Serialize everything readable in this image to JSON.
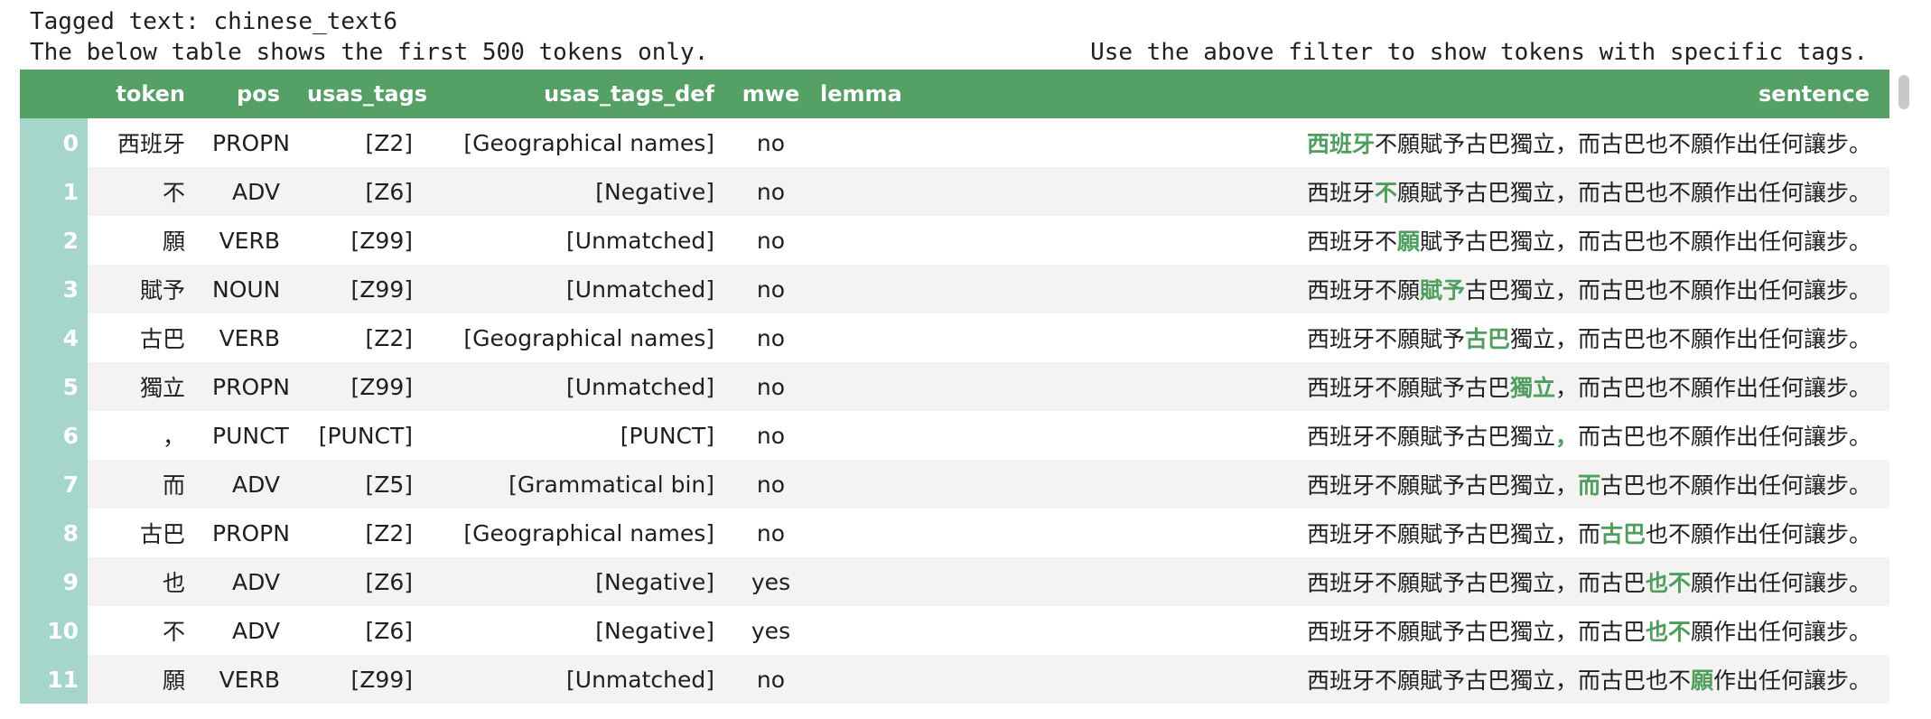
{
  "caption": {
    "title": "Tagged text: chinese_text6",
    "left_note": "The below table shows the first 500 tokens only.",
    "right_note": "Use the above filter to show tokens with specific tags."
  },
  "table": {
    "headers": {
      "index": "",
      "token": "token",
      "pos": "pos",
      "usas_tags": "usas_tags",
      "usas_tags_def": "usas_tags_def",
      "mwe": "mwe",
      "lemma": "lemma",
      "sentence": "sentence"
    },
    "rows": [
      {
        "index": "0",
        "token": "西班牙",
        "pos": "PROPN",
        "usas_tags": "[Z2]",
        "usas_tags_def": "[Geographical names]",
        "mwe": "no",
        "lemma": "",
        "sentence": {
          "before": "",
          "highlight": "西班牙",
          "after": "不願賦予古巴獨立，而古巴也不願作出任何讓步。"
        }
      },
      {
        "index": "1",
        "token": "不",
        "pos": "ADV",
        "usas_tags": "[Z6]",
        "usas_tags_def": "[Negative]",
        "mwe": "no",
        "lemma": "",
        "sentence": {
          "before": "西班牙",
          "highlight": "不",
          "after": "願賦予古巴獨立，而古巴也不願作出任何讓步。"
        }
      },
      {
        "index": "2",
        "token": "願",
        "pos": "VERB",
        "usas_tags": "[Z99]",
        "usas_tags_def": "[Unmatched]",
        "mwe": "no",
        "lemma": "",
        "sentence": {
          "before": "西班牙不",
          "highlight": "願",
          "after": "賦予古巴獨立，而古巴也不願作出任何讓步。"
        }
      },
      {
        "index": "3",
        "token": "賦予",
        "pos": "NOUN",
        "usas_tags": "[Z99]",
        "usas_tags_def": "[Unmatched]",
        "mwe": "no",
        "lemma": "",
        "sentence": {
          "before": "西班牙不願",
          "highlight": "賦予",
          "after": "古巴獨立，而古巴也不願作出任何讓步。"
        }
      },
      {
        "index": "4",
        "token": "古巴",
        "pos": "VERB",
        "usas_tags": "[Z2]",
        "usas_tags_def": "[Geographical names]",
        "mwe": "no",
        "lemma": "",
        "sentence": {
          "before": "西班牙不願賦予",
          "highlight": "古巴",
          "after": "獨立，而古巴也不願作出任何讓步。"
        }
      },
      {
        "index": "5",
        "token": "獨立",
        "pos": "PROPN",
        "usas_tags": "[Z99]",
        "usas_tags_def": "[Unmatched]",
        "mwe": "no",
        "lemma": "",
        "sentence": {
          "before": "西班牙不願賦予古巴",
          "highlight": "獨立",
          "after": "，而古巴也不願作出任何讓步。"
        }
      },
      {
        "index": "6",
        "token": "，",
        "pos": "PUNCT",
        "usas_tags": "[PUNCT]",
        "usas_tags_def": "[PUNCT]",
        "mwe": "no",
        "lemma": "",
        "sentence": {
          "before": "西班牙不願賦予古巴獨立",
          "highlight": "，",
          "after": "而古巴也不願作出任何讓步。"
        }
      },
      {
        "index": "7",
        "token": "而",
        "pos": "ADV",
        "usas_tags": "[Z5]",
        "usas_tags_def": "[Grammatical bin]",
        "mwe": "no",
        "lemma": "",
        "sentence": {
          "before": "西班牙不願賦予古巴獨立，",
          "highlight": "而",
          "after": "古巴也不願作出任何讓步。"
        }
      },
      {
        "index": "8",
        "token": "古巴",
        "pos": "PROPN",
        "usas_tags": "[Z2]",
        "usas_tags_def": "[Geographical names]",
        "mwe": "no",
        "lemma": "",
        "sentence": {
          "before": "西班牙不願賦予古巴獨立，而",
          "highlight": "古巴",
          "after": "也不願作出任何讓步。"
        }
      },
      {
        "index": "9",
        "token": "也",
        "pos": "ADV",
        "usas_tags": "[Z6]",
        "usas_tags_def": "[Negative]",
        "mwe": "yes",
        "lemma": "",
        "sentence": {
          "before": "西班牙不願賦予古巴獨立，而古巴",
          "highlight": "也不",
          "after": "願作出任何讓步。"
        }
      },
      {
        "index": "10",
        "token": "不",
        "pos": "ADV",
        "usas_tags": "[Z6]",
        "usas_tags_def": "[Negative]",
        "mwe": "yes",
        "lemma": "",
        "sentence": {
          "before": "西班牙不願賦予古巴獨立，而古巴",
          "highlight": "也不",
          "after": "願作出任何讓步。"
        }
      },
      {
        "index": "11",
        "token": "願",
        "pos": "VERB",
        "usas_tags": "[Z99]",
        "usas_tags_def": "[Unmatched]",
        "mwe": "no",
        "lemma": "",
        "sentence": {
          "before": "西班牙不願賦予古巴獨立，而古巴也不",
          "highlight": "願",
          "after": "作出任何讓步。"
        }
      }
    ]
  },
  "colors": {
    "header_green": "#55a065",
    "index_teal": "#a6d5c9",
    "highlight_green": "#4f9e5e",
    "stripe_gray": "#f3f3f3"
  }
}
